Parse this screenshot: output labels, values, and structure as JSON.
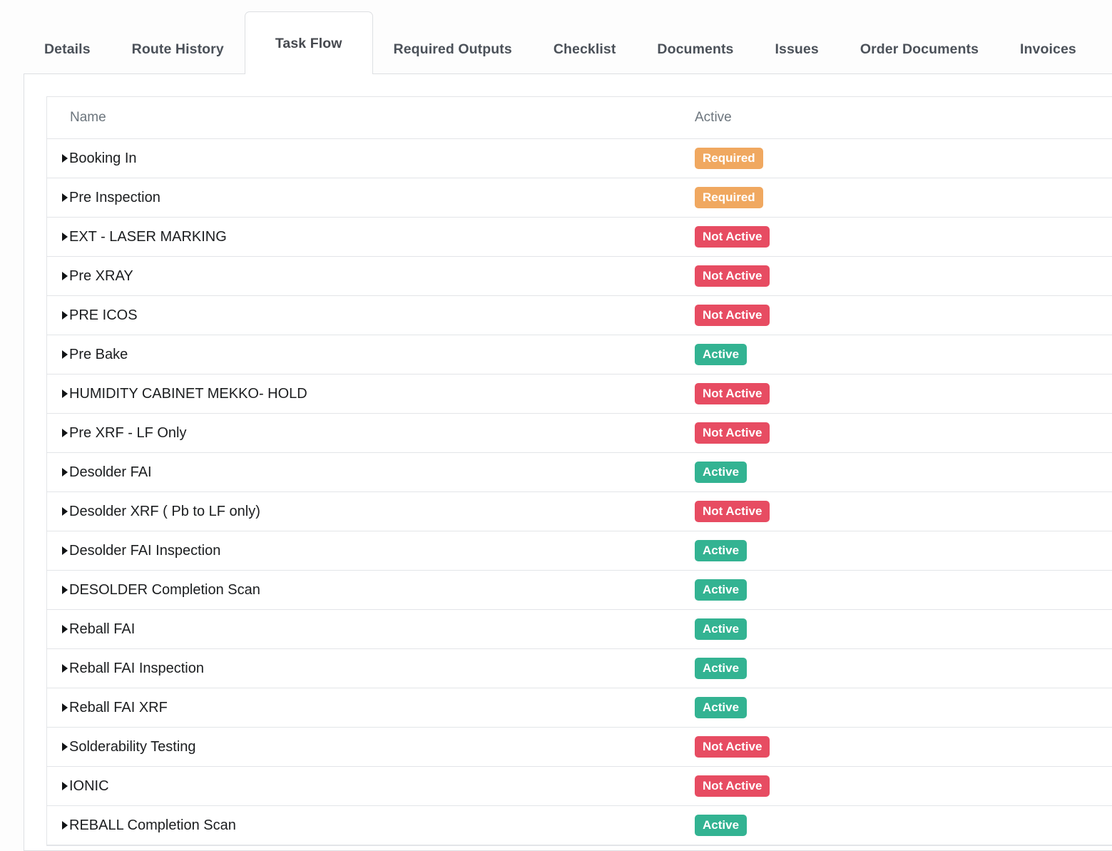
{
  "tabs": [
    {
      "label": "Details",
      "active": false
    },
    {
      "label": "Route History",
      "active": false
    },
    {
      "label": "Task Flow",
      "active": true
    },
    {
      "label": "Required Outputs",
      "active": false
    },
    {
      "label": "Checklist",
      "active": false
    },
    {
      "label": "Documents",
      "active": false
    },
    {
      "label": "Issues",
      "active": false
    },
    {
      "label": "Order Documents",
      "active": false
    },
    {
      "label": "Invoices",
      "active": false
    }
  ],
  "table": {
    "columns": [
      "Name",
      "Active"
    ],
    "rows": [
      {
        "name": "Booking In",
        "status": "Required",
        "status_type": "required"
      },
      {
        "name": "Pre Inspection",
        "status": "Required",
        "status_type": "required"
      },
      {
        "name": "EXT - LASER MARKING",
        "status": "Not Active",
        "status_type": "notactive"
      },
      {
        "name": "Pre XRAY",
        "status": "Not Active",
        "status_type": "notactive"
      },
      {
        "name": "PRE ICOS",
        "status": "Not Active",
        "status_type": "notactive"
      },
      {
        "name": "Pre Bake",
        "status": "Active",
        "status_type": "active"
      },
      {
        "name": "HUMIDITY CABINET MEKKO- HOLD",
        "status": "Not Active",
        "status_type": "notactive"
      },
      {
        "name": "Pre XRF - LF Only",
        "status": "Not Active",
        "status_type": "notactive"
      },
      {
        "name": "Desolder FAI",
        "status": "Active",
        "status_type": "active"
      },
      {
        "name": "Desolder XRF ( Pb to LF only)",
        "status": "Not Active",
        "status_type": "notactive"
      },
      {
        "name": "Desolder FAI Inspection",
        "status": "Active",
        "status_type": "active"
      },
      {
        "name": "DESOLDER Completion Scan",
        "status": "Active",
        "status_type": "active"
      },
      {
        "name": "Reball FAI",
        "status": "Active",
        "status_type": "active"
      },
      {
        "name": "Reball FAI Inspection",
        "status": "Active",
        "status_type": "active"
      },
      {
        "name": "Reball FAI XRF",
        "status": "Active",
        "status_type": "active"
      },
      {
        "name": "Solderability Testing",
        "status": "Not Active",
        "status_type": "notactive"
      },
      {
        "name": "IONIC",
        "status": "Not Active",
        "status_type": "notactive"
      },
      {
        "name": "REBALL Completion Scan",
        "status": "Active",
        "status_type": "active"
      }
    ]
  },
  "colors": {
    "badge_required": "#f0a860",
    "badge_not_active": "#e74c62",
    "badge_active": "#33b392",
    "border": "#e3e5e8",
    "tab_text": "#4b5159",
    "header_text": "#6c757d"
  }
}
